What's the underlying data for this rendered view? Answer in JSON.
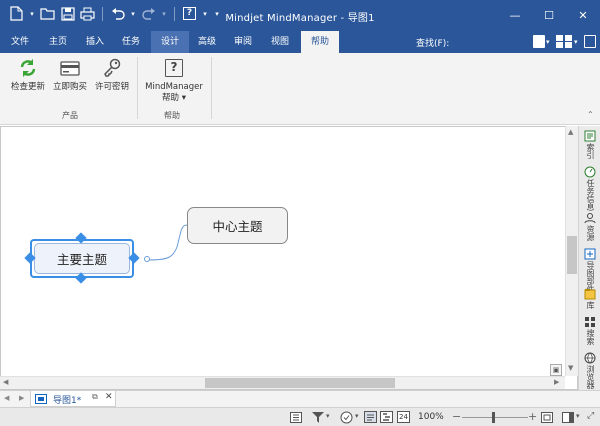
{
  "window": {
    "title": "Mindjet MindManager - 导图1",
    "minimize_glyph": "—",
    "restore_glyph": "☐",
    "close_glyph": "✕"
  },
  "qat": {
    "help_glyph": "?"
  },
  "tabs": [
    "文件",
    "主页",
    "插入",
    "任务",
    "设计",
    "高级",
    "审阅",
    "视图",
    "帮助"
  ],
  "find_label": "查找(F):",
  "ribbon": {
    "groups": [
      {
        "label": "产品",
        "buttons": [
          {
            "label": "检查更新",
            "icon": "refresh-icon"
          },
          {
            "label": "立即购买",
            "icon": "credit-card-icon"
          },
          {
            "label": "许可密钥",
            "icon": "key-icon"
          }
        ]
      },
      {
        "label": "帮助",
        "buttons": [
          {
            "label": "MindManager",
            "sublabel": "帮助 ▾",
            "icon": "help-icon"
          }
        ]
      }
    ]
  },
  "canvas": {
    "central_topic": "中心主题",
    "main_topic": "主要主题"
  },
  "side_panel": [
    {
      "label": "索引",
      "icon": "index-icon"
    },
    {
      "label": "任务信息",
      "icon": "task-info-icon"
    },
    {
      "label": "资源",
      "icon": "resource-icon"
    },
    {
      "label": "导图部件",
      "icon": "map-parts-icon"
    },
    {
      "label": "库",
      "icon": "library-icon"
    },
    {
      "label": "搜索",
      "icon": "search-icon"
    },
    {
      "label": "浏览器",
      "icon": "browser-icon"
    }
  ],
  "doc_tab": {
    "name": "导图1*"
  },
  "status": {
    "zoom": "100%",
    "zoom_minus": "−",
    "zoom_plus": "+",
    "calendar_day": "24"
  },
  "colors": {
    "titlebar": "#2b579a",
    "selection": "#3a8ee6",
    "topic_fill": "#f2f2f2"
  }
}
